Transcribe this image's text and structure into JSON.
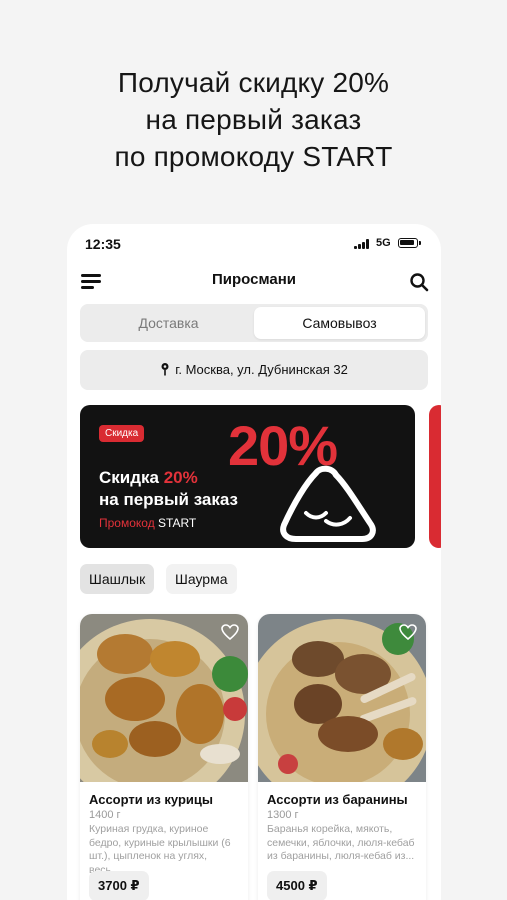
{
  "promo": {
    "line1": "Получай скидку 20%",
    "line2": "на первый заказ",
    "line3": "по промокоду START"
  },
  "status_bar": {
    "time": "12:35",
    "network": "5G"
  },
  "header": {
    "title": "Пиросмани",
    "menu_icon": "menu-icon",
    "search_icon": "search-icon"
  },
  "mode_toggle": {
    "delivery": "Доставка",
    "pickup": "Самовывоз",
    "selected": "pickup"
  },
  "address": {
    "text": "г. Москва, ул. Дубнинская 32",
    "icon": "location-pin-icon"
  },
  "banner": {
    "badge": "Скидка",
    "big": "20%",
    "title_prefix": "Скидка ",
    "title_highlight": "20%",
    "title_line2": "на первый заказ",
    "code_label": "Промокод",
    "code": " START",
    "accent": "#e2323a"
  },
  "categories": [
    {
      "label": "Шашлык",
      "active": true
    },
    {
      "label": "Шаурма",
      "active": false
    }
  ],
  "products": [
    {
      "name": "Ассорти из курицы",
      "weight": "1400 г",
      "description": "Куриная грудка, куриное бедро, куриные крылышки (6 шт.), цыпленок на углях, весь...",
      "price": "3700 ₽"
    },
    {
      "name": "Ассорти из баранины",
      "weight": "1300 г",
      "description": "Баранья корейка, мякоть, семечки, яблочки, люля-кебаб из баранины, люля-кебаб из...",
      "price": "4500 ₽"
    }
  ]
}
